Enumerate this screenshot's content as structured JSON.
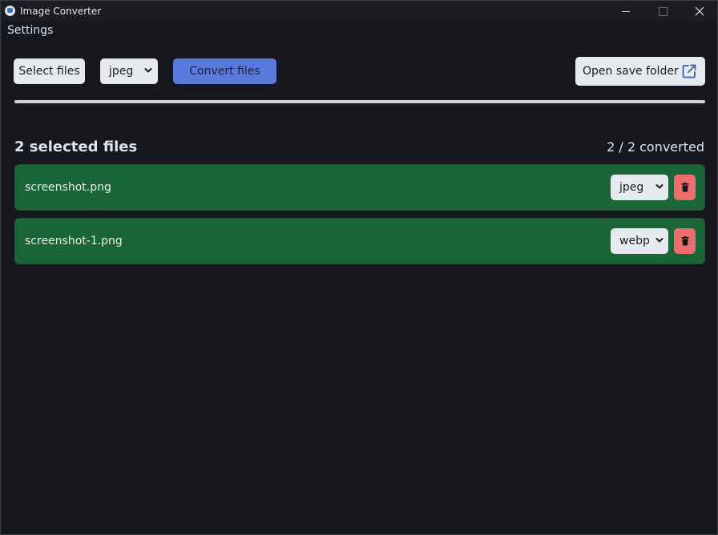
{
  "window": {
    "title": "Image Converter",
    "controls": [
      "minimize",
      "maximize",
      "close"
    ]
  },
  "menu": {
    "settings_label": "Settings"
  },
  "toolbar": {
    "select_files_label": "Select files",
    "format_value": "jpeg",
    "convert_label": "Convert files",
    "open_folder_label": "Open save folder"
  },
  "progress": {
    "fraction": 1.0
  },
  "files": {
    "heading": "2 selected files",
    "status": "2 / 2 converted",
    "items": [
      {
        "name": "screenshot.png",
        "format": "jpeg"
      },
      {
        "name": "screenshot-1.png",
        "format": "webp"
      }
    ]
  },
  "colors": {
    "background": "#17181d",
    "accent": "#5b78dd",
    "row_converted": "#1a6638",
    "delete": "#ed6c6e"
  },
  "icons": {
    "app": "app-icon",
    "format_dropdown": "chevron-down-icon",
    "open_folder": "external-link-icon",
    "delete": "trash-icon"
  }
}
